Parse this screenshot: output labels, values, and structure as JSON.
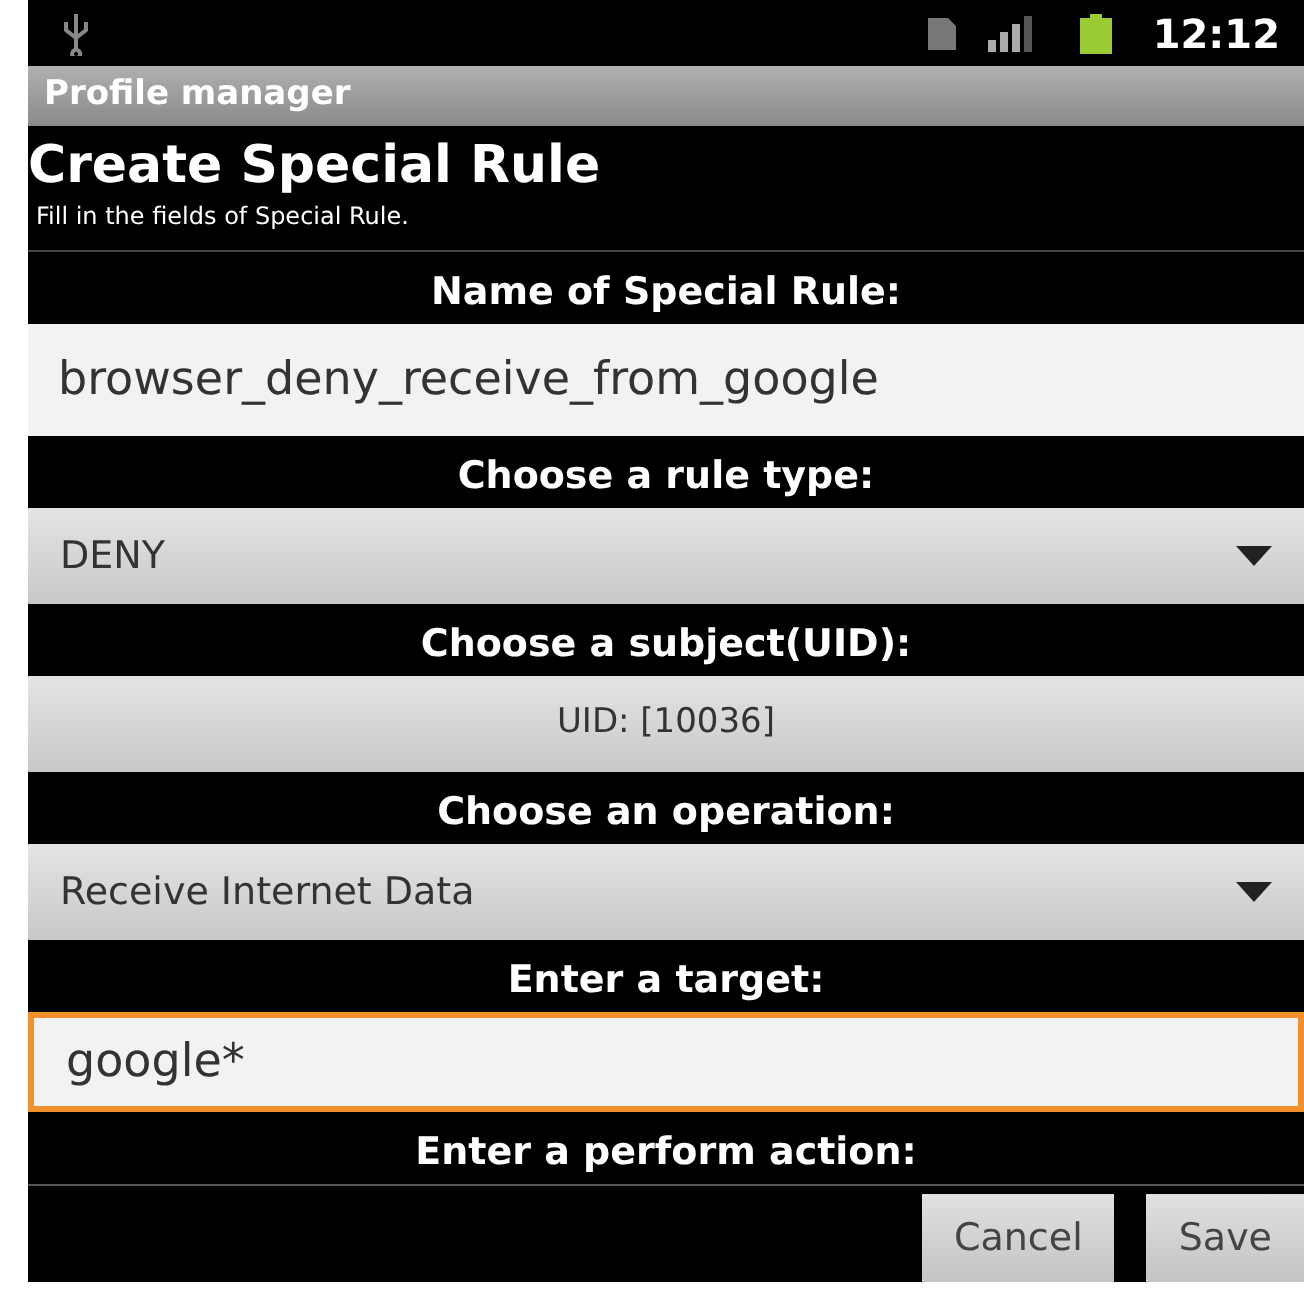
{
  "status_bar": {
    "time": "12:12"
  },
  "app_title": "Profile manager",
  "header": {
    "title": "Create Special Rule",
    "subtitle": "Fill in the fields of Special Rule."
  },
  "form": [
    {
      "kind": "text",
      "label": "Name of Special Rule:",
      "value": "browser_deny_receive_from_google",
      "focused": false
    },
    {
      "kind": "spinner",
      "label": "Choose a rule type:",
      "value": "DENY"
    },
    {
      "kind": "button",
      "label": "Choose a subject(UID):",
      "value": "UID: [10036]"
    },
    {
      "kind": "spinner",
      "label": "Choose an operation:",
      "value": "Receive Internet Data"
    },
    {
      "kind": "text",
      "label": "Enter a target:",
      "value": "google*",
      "focused": true
    },
    {
      "kind": "label",
      "label": "Enter a perform action:"
    }
  ],
  "buttons": [
    "Cancel",
    "Save"
  ]
}
